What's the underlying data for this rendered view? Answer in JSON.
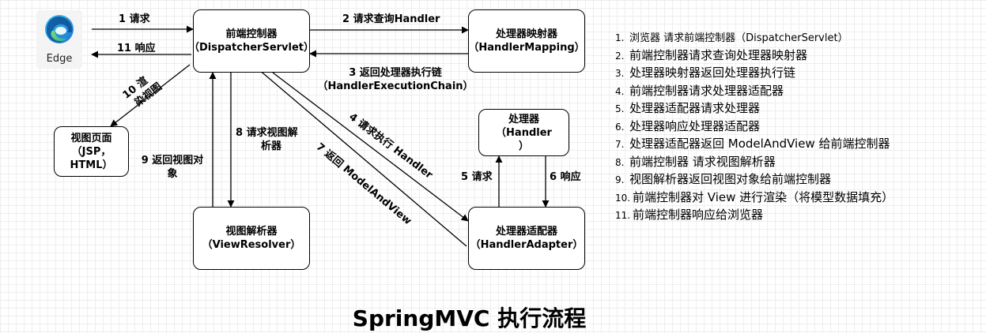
{
  "browser": {
    "label": "Edge"
  },
  "nodes": {
    "dispatcher": [
      "前端控制器",
      "（DispatcherServlet）"
    ],
    "handler_mapping": [
      "处理器映射器",
      "（HandlerMapping）"
    ],
    "handler": [
      "处理器",
      "（Handler",
      "）"
    ],
    "handler_adapter": [
      "处理器适配器",
      "（HandlerAdapter）"
    ],
    "view_resolver": [
      "视图解析器",
      "（ViewResolver）"
    ],
    "view": [
      "视图页面",
      "（JSP，",
      "HTML）"
    ]
  },
  "edge_labels": {
    "e1": "1  请求",
    "e11": "11  响应",
    "e2": "2  请求查询Handler",
    "e3": [
      "3  返回处理器执行链",
      "（HandlerExecutionChain）"
    ],
    "e4": "4  请求执行 Handler",
    "e5": "5  请求",
    "e6": "6  响应",
    "e7": "7 返回 ModelAndView",
    "e8": [
      "8 请求视图解",
      "析器"
    ],
    "e9": [
      "9  返回视图对",
      "象"
    ],
    "e10": [
      "10  渲",
      "染视图"
    ]
  },
  "steps": [
    "浏览器 请求前端控制器（DispatcherServlet）",
    "前端控制器请求查询处理器映射器",
    "处理器映射器返回处理器执行链",
    "前端控制器请求处理器适配器",
    "处理器适配器请求处理器",
    "处理器响应处理器适配器",
    "处理器适配器返回 ModelAndView 给前端控制器",
    "前端控制器 请求视图解析器",
    "视图解析器返回视图对象给前端控制器",
    "前端控制器对 View 进行渲染（将模型数据填充）",
    "前端控制器响应给浏览器"
  ],
  "footer": {
    "title": "SpringMVC 执行流程"
  }
}
